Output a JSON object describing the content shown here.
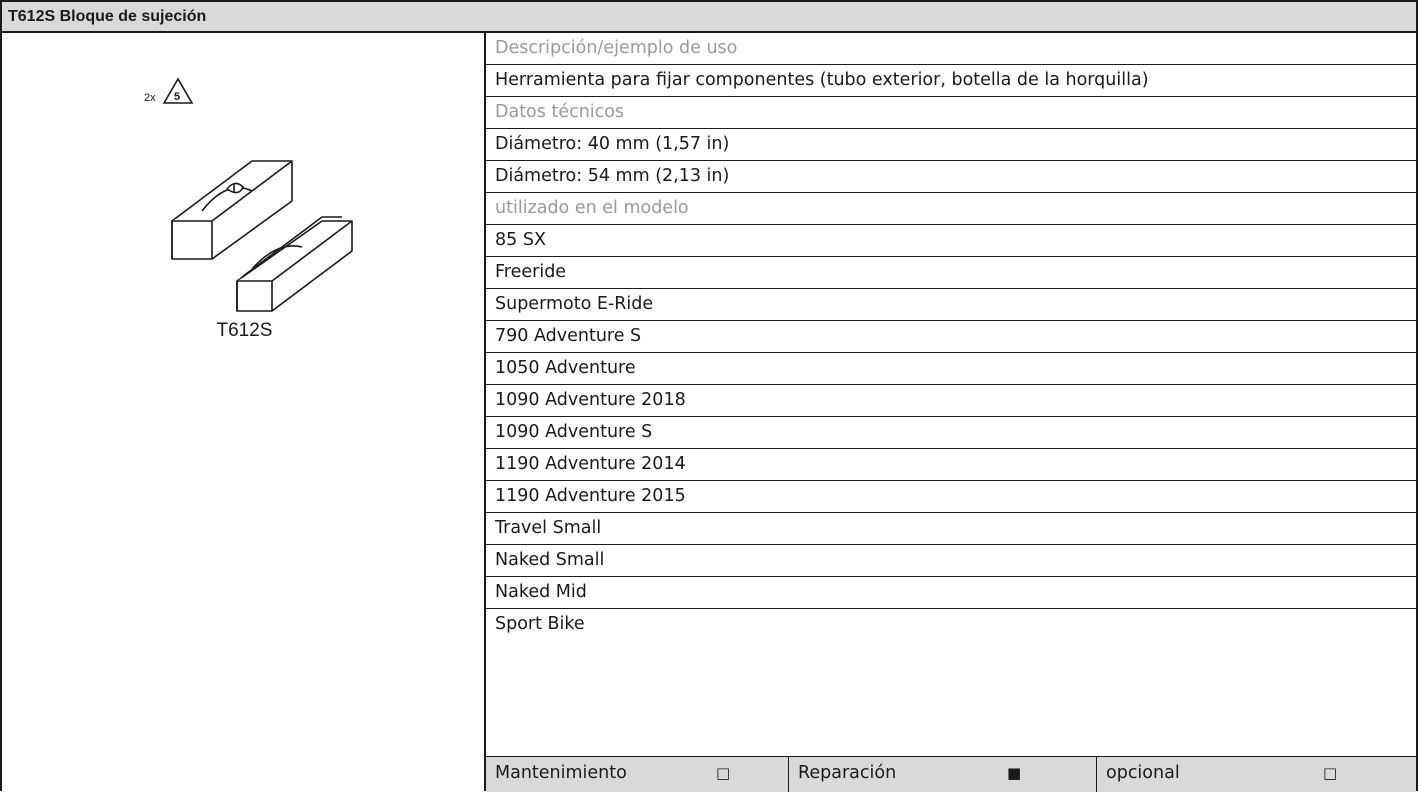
{
  "header": {
    "title": "T612S Bloque de sujeción"
  },
  "figure": {
    "quantity": "2x",
    "symbol_number": "5",
    "code": "T612S"
  },
  "content": {
    "desc_label": "Descripción/ejemplo de uso",
    "desc_text": "Herramienta para fijar componentes (tubo exterior, botella de la horquilla)",
    "tech_label": "Datos técnicos",
    "tech_items": [
      "Diámetro: 40 mm (1,57 in)",
      "Diámetro: 54 mm (2,13 in)"
    ],
    "models_label": "utilizado en el modelo",
    "models": [
      "85 SX",
      "Freeride",
      "Supermoto E-Ride",
      "790 Adventure S",
      "1050 Adventure",
      "1090 Adventure 2018",
      "1090 Adventure S",
      "1190 Adventure 2014",
      "1190 Adventure 2015",
      "Travel Small",
      "Naked Small",
      "Naked Mid",
      "Sport Bike"
    ]
  },
  "footer": {
    "maintenance": {
      "label": "Mantenimiento",
      "mark": "□"
    },
    "repair": {
      "label": "Reparación",
      "mark": "■"
    },
    "optional": {
      "label": "opcional",
      "mark": "□"
    }
  }
}
